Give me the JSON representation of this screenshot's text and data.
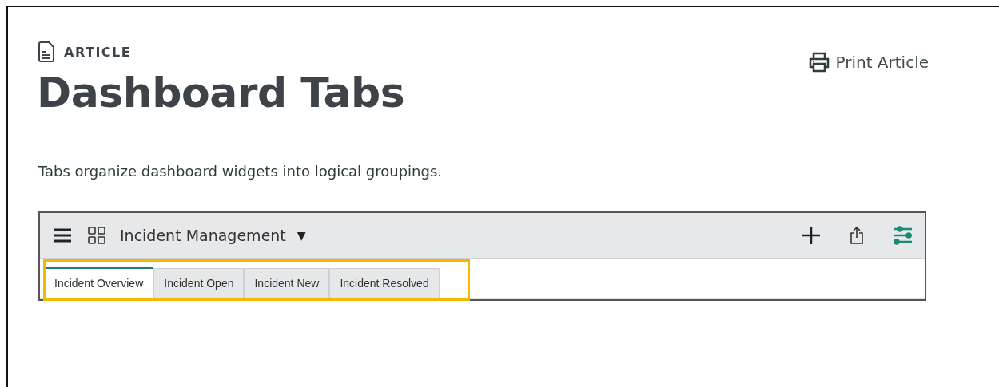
{
  "article": {
    "label": "ARTICLE",
    "title": "Dashboard Tabs",
    "print_link": "Print Article",
    "description": "Tabs organize dashboard widgets into logical groupings."
  },
  "dashboard": {
    "title": "Incident Management",
    "dropdown_caret": "▼",
    "tabs": [
      {
        "label": "Incident Overview",
        "selected": true
      },
      {
        "label": "Incident Open",
        "selected": false
      },
      {
        "label": "Incident New",
        "selected": false
      },
      {
        "label": "Incident Resolved",
        "selected": false
      }
    ]
  }
}
